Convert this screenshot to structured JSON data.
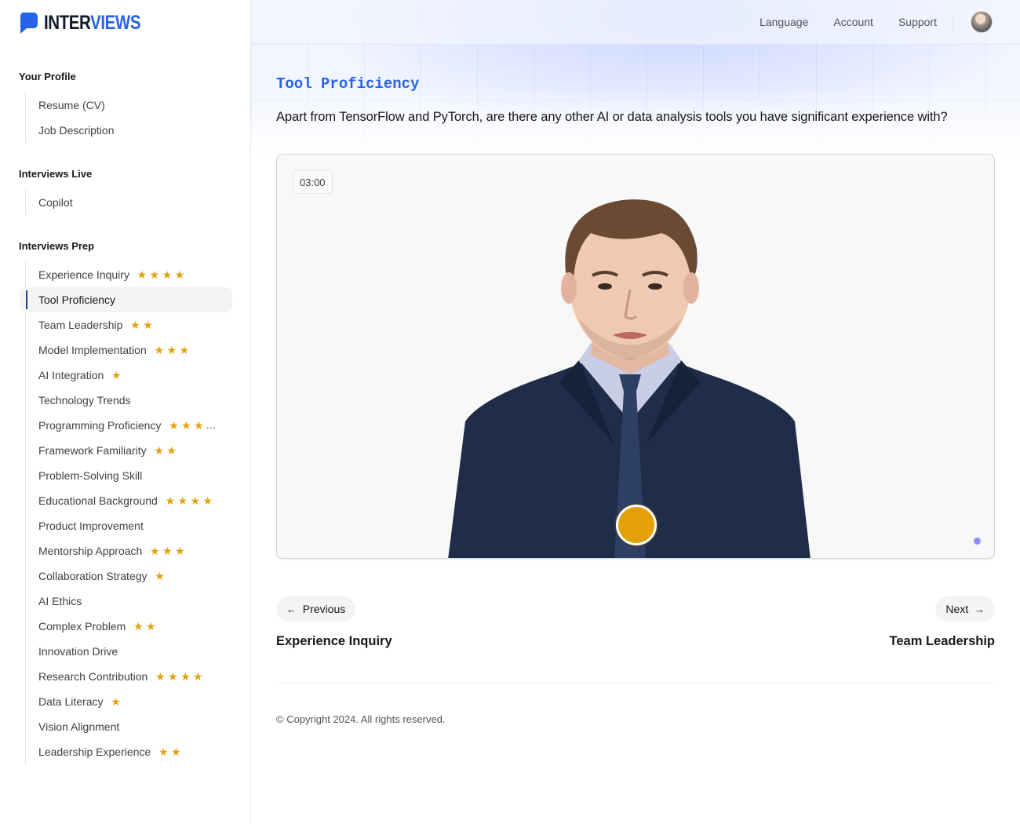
{
  "brand": {
    "part1": "INTER",
    "part2": "VIEWS"
  },
  "header": {
    "nav": [
      "Language",
      "Account",
      "Support"
    ]
  },
  "sidebar": {
    "sections": [
      {
        "title": "Your Profile",
        "items": [
          {
            "label": "Resume (CV)",
            "stars": 0
          },
          {
            "label": "Job Description",
            "stars": 0
          }
        ]
      },
      {
        "title": "Interviews Live",
        "items": [
          {
            "label": "Copilot",
            "stars": 0
          }
        ]
      },
      {
        "title": "Interviews Prep",
        "items": [
          {
            "label": "Experience Inquiry",
            "stars": 4
          },
          {
            "label": "Tool Proficiency",
            "stars": 0,
            "active": true
          },
          {
            "label": "Team Leadership",
            "stars": 2
          },
          {
            "label": "Model Implementation",
            "stars": 3
          },
          {
            "label": "AI Integration",
            "stars": 1
          },
          {
            "label": "Technology Trends",
            "stars": 0
          },
          {
            "label": "Programming Proficiency",
            "stars": 3,
            "truncated": true
          },
          {
            "label": "Framework Familiarity",
            "stars": 2
          },
          {
            "label": "Problem-Solving Skill",
            "stars": 0
          },
          {
            "label": "Educational Background",
            "stars": 4
          },
          {
            "label": "Product Improvement",
            "stars": 0
          },
          {
            "label": "Mentorship Approach",
            "stars": 3
          },
          {
            "label": "Collaboration Strategy",
            "stars": 1
          },
          {
            "label": "AI Ethics",
            "stars": 0
          },
          {
            "label": "Complex Problem",
            "stars": 2
          },
          {
            "label": "Innovation Drive",
            "stars": 0
          },
          {
            "label": "Research Contribution",
            "stars": 4
          },
          {
            "label": "Data Literacy",
            "stars": 1
          },
          {
            "label": "Vision Alignment",
            "stars": 0
          },
          {
            "label": "Leadership Experience",
            "stars": 2
          }
        ]
      }
    ]
  },
  "main": {
    "title": "Tool Proficiency",
    "question": "Apart from TensorFlow and PyTorch, are there any other AI or data analysis tools you have significant experience with?",
    "timer": "03:00",
    "prev": {
      "button": "Previous",
      "arrow": "←",
      "label": "Experience Inquiry"
    },
    "next": {
      "button": "Next",
      "arrow": "→",
      "label": "Team Leadership"
    }
  },
  "footer": {
    "text": "© Copyright 2024. All rights reserved."
  },
  "colors": {
    "accent": "#2563eb",
    "star": "#e3a008",
    "record": "#e3a008"
  },
  "icons": {
    "star": "★",
    "logo": "speech-bubble-icon",
    "avatar": "user-avatar"
  }
}
